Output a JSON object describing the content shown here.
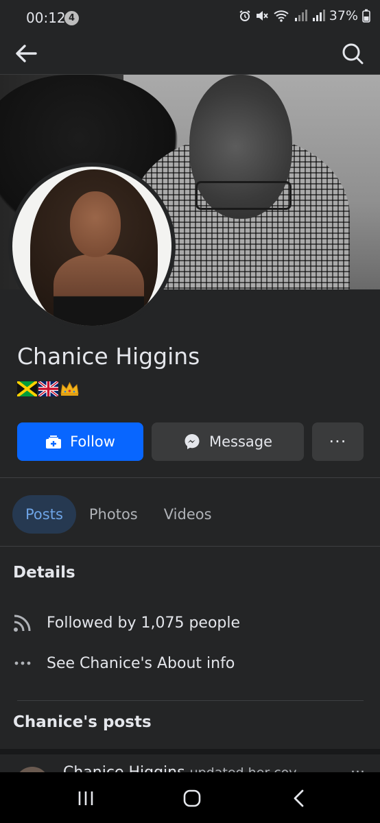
{
  "status_bar": {
    "time": "00:12",
    "notification_count": "4",
    "battery": "37%"
  },
  "app_bar": {
    "back_icon": "arrow-left-icon",
    "search_icon": "search-icon"
  },
  "profile": {
    "name": "Chanice Higgins",
    "bio_flags": [
      "jamaica-flag",
      "uk-flag",
      "crown-emoji"
    ]
  },
  "actions": {
    "follow_label": "Follow",
    "message_label": "Message",
    "more_label": "···"
  },
  "tabs": [
    {
      "label": "Posts",
      "active": true
    },
    {
      "label": "Photos",
      "active": false
    },
    {
      "label": "Videos",
      "active": false
    }
  ],
  "details": {
    "title": "Details",
    "followers_text": "Followed by 1,075 people",
    "about_text": "See Chanice's About info"
  },
  "posts": {
    "title": "Chanice's posts",
    "peek_author": "Chanice Higgins",
    "peek_action": "updated her cov",
    "peek_more": "···"
  },
  "colors": {
    "background": "#242526",
    "primary_button": "#0866ff",
    "secondary_button": "#3a3b3c",
    "active_tab_bg": "#263951",
    "active_tab_text": "#6ea4e6"
  }
}
